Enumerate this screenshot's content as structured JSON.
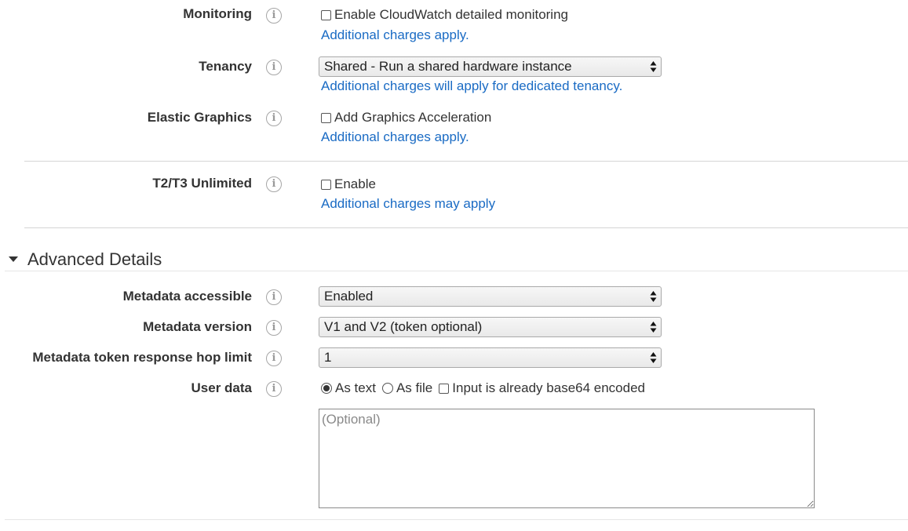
{
  "monitoring": {
    "label": "Monitoring",
    "checkbox_label": "Enable CloudWatch detailed monitoring",
    "checked": false,
    "link": "Additional charges apply."
  },
  "tenancy": {
    "label": "Tenancy",
    "selected": "Shared - Run a shared hardware instance",
    "link": "Additional charges will apply for dedicated tenancy."
  },
  "elastic_graphics": {
    "label": "Elastic Graphics",
    "checkbox_label": "Add Graphics Acceleration",
    "checked": false,
    "link": "Additional charges apply."
  },
  "unlimited": {
    "label": "T2/T3 Unlimited",
    "checkbox_label": "Enable",
    "checked": false,
    "link": "Additional charges may apply"
  },
  "advanced": {
    "title": "Advanced Details",
    "metadata_accessible": {
      "label": "Metadata accessible",
      "selected": "Enabled"
    },
    "metadata_version": {
      "label": "Metadata version",
      "selected": "V1 and V2 (token optional)"
    },
    "hop_limit": {
      "label": "Metadata token response hop limit",
      "selected": "1"
    },
    "user_data": {
      "label": "User data",
      "as_text": "As text",
      "as_file": "As file",
      "selected_option": "As text",
      "base64_label": "Input is already base64 encoded",
      "base64_checked": false,
      "placeholder": "(Optional)"
    }
  },
  "icons": {
    "info": "info-icon",
    "info_glyph": "i",
    "select_arrows": "select-arrows-icon",
    "section_toggle": "caret-down-icon"
  },
  "colors": {
    "link": "#1a6bc4",
    "text": "#333333",
    "divider": "#d5d5d5"
  }
}
